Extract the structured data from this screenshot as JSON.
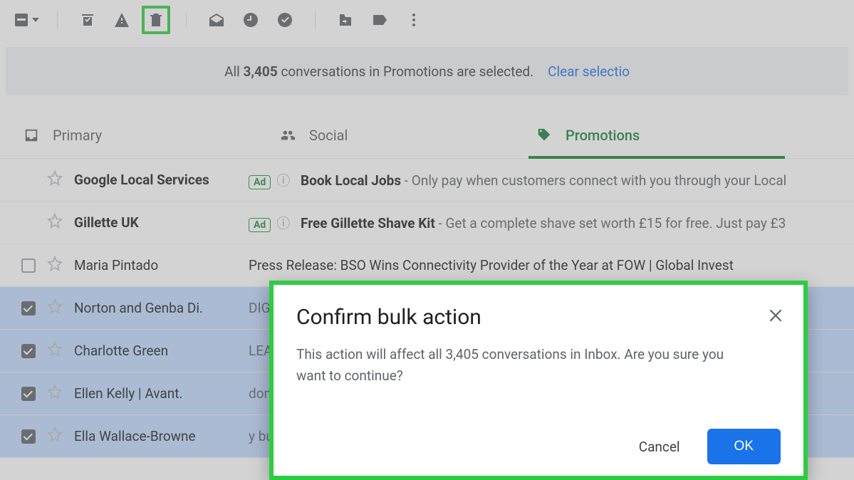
{
  "banner": {
    "prefix": "All ",
    "count": "3,405",
    "suffix": " conversations in Promotions are selected.",
    "clear": "Clear selectio"
  },
  "tabs": {
    "primary": "Primary",
    "social": "Social",
    "promotions": "Promotions"
  },
  "adBadge": "Ad",
  "rows": [
    {
      "sender": "Google Local Services",
      "subject": "Book Local Jobs",
      "snippet": " - Only pay when customers connect with you through your Local",
      "ad": true,
      "bold": true
    },
    {
      "sender": "Gillette UK",
      "subject": "Free Gillette Shave Kit",
      "snippet": " - Get a complete shave set worth £15 for free. Just pay £3",
      "ad": true,
      "bold": true
    },
    {
      "sender": "Maria Pintado",
      "subject": "Press Release: BSO Wins Connectivity Provider of the Year  at FOW | Global Invest",
      "snippet": "",
      "selected": false,
      "checkbox": true
    },
    {
      "sender": "Norton and Genba Di.",
      "subject": "",
      "snippet": "DIGITAL",
      "selected": true,
      "checkbox": true,
      "checked": true
    },
    {
      "sender": "Charlotte Green",
      "subject": "",
      "snippet": "LEASE F",
      "selected": true,
      "checkbox": true,
      "checked": true
    },
    {
      "sender": "Ellen Kelly | Avant.",
      "subject": "",
      "snippet": "don't he",
      "selected": true,
      "checkbox": true,
      "checked": true
    },
    {
      "sender": "Ella Wallace-Browne",
      "subject": "",
      "snippet": "y busine",
      "selected": true,
      "checkbox": true,
      "checked": true
    }
  ],
  "modal": {
    "title": "Confirm bulk action",
    "body": "This action will affect all 3,405 conversations in Inbox. Are you sure you want to continue?",
    "cancel": "Cancel",
    "ok": "OK"
  }
}
